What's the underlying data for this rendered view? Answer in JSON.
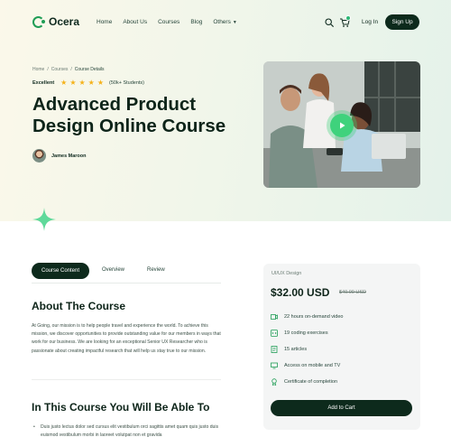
{
  "header": {
    "logo_text": "Ocera",
    "nav": [
      "Home",
      "About Us",
      "Courses",
      "Blog",
      "Others"
    ],
    "login_label": "Log In",
    "signup_label": "Sign Up"
  },
  "hero": {
    "breadcrumb": [
      "Home",
      "Courses",
      "Course Details"
    ],
    "rating_label": "Excellent",
    "rating_stars": 5,
    "rating_count": "(50k+ Students)",
    "title": "Advanced Product Design Online Course",
    "author_name": "James Maroon"
  },
  "tabs": [
    "Course Content",
    "Overview",
    "Review"
  ],
  "about": {
    "heading": "About The Course",
    "text": "At Going, our mission is to help people travel and experience the world. To achieve this mission, we discover opportunities to provide outstanding value for our members in ways that work for our business. We are looking for an exceptional Senior UX Researcher who is passionate about creating impactful research that will help us stay true to our mission."
  },
  "learn": {
    "heading": "In This Course You Will Be Able To",
    "bullet": "Duis justo lectus dolor sed cursus elit vestibulum orci sagittis amet quam quis justo duis euismod vestibulum morbi in laoreet volutpat non et gravida"
  },
  "card": {
    "category": "UI/UX Design",
    "price": "$32.00 USD",
    "old_price": "$40.00 USD",
    "features": [
      {
        "label": "22 hours on-demand video",
        "icon": "video-icon"
      },
      {
        "label": "19 coding exercises",
        "icon": "code-icon"
      },
      {
        "label": "15 articles",
        "icon": "article-icon"
      },
      {
        "label": "Access on mobile and TV",
        "icon": "device-icon"
      },
      {
        "label": "Certificate of completion",
        "icon": "certificate-icon"
      }
    ],
    "cta_label": "Add to Cart"
  },
  "colors": {
    "primary_dark": "#0d2a1c",
    "accent_green": "#3fd27c",
    "star": "#f5b21b"
  }
}
